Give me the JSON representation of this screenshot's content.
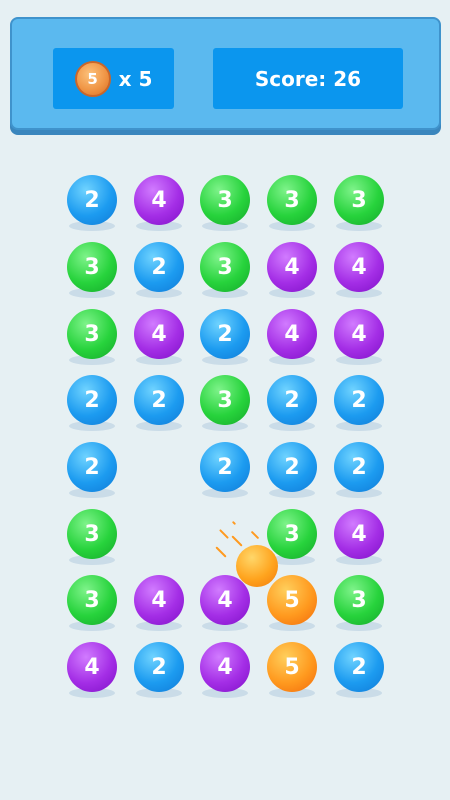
{
  "header": {
    "moves": {
      "icon": "orange-ball-icon",
      "ball_value": "5",
      "count_label": "x 5"
    },
    "score_label": "Score: 26"
  },
  "colors": {
    "2": "#1c9bf0",
    "3": "#27d33c",
    "4": "#a42ee6",
    "5": "#ff9a1f"
  },
  "board": {
    "rows": [
      [
        "2",
        "4",
        "3",
        "3",
        "3"
      ],
      [
        "3",
        "2",
        "3",
        "4",
        "4"
      ],
      [
        "3",
        "4",
        "2",
        "4",
        "4"
      ],
      [
        "2",
        "2",
        "3",
        "2",
        "2"
      ],
      [
        "2",
        "",
        "2",
        "2",
        "2"
      ],
      [
        "3",
        "",
        "",
        "3",
        "4"
      ],
      [
        "3",
        "4",
        "4",
        "5",
        "3"
      ],
      [
        "4",
        "2",
        "4",
        "5",
        "2"
      ]
    ],
    "falling_ball": {
      "icon": "orange-ball-icon",
      "value": "",
      "column": 4,
      "row": 6
    }
  }
}
